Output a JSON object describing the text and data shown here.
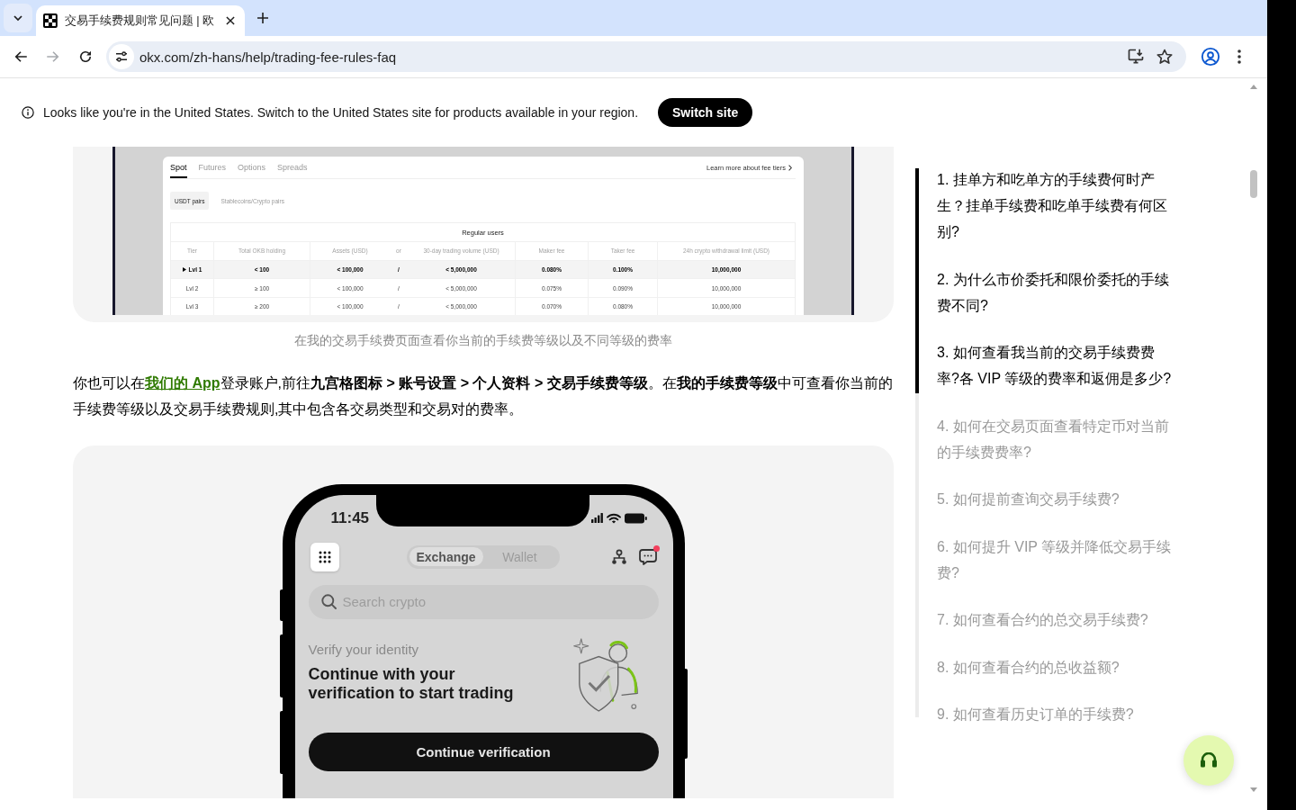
{
  "browser": {
    "tab_title": "交易手续费规则常见问题 | 欧",
    "nav_buttons": [
      {
        "kind": "back",
        "disabled": false
      },
      {
        "kind": "forward",
        "disabled": true
      },
      {
        "kind": "reload",
        "disabled": false
      }
    ],
    "address": "okx.com/zh-hans/help/trading-fee-rules-faq"
  },
  "region_banner": {
    "message": "Looks like you're in the United States. Switch to the United States site for products available in your region.",
    "button": "Switch site"
  },
  "fee_screenshot": {
    "tabs": [
      {
        "label": "Spot",
        "selected": true
      },
      {
        "label": "Futures",
        "selected": false
      },
      {
        "label": "Options",
        "selected": false
      },
      {
        "label": "Spreads",
        "selected": false
      }
    ],
    "fee_link": "Learn more about fee tiers",
    "pair_tabs": [
      {
        "label": "USDT pairs",
        "selected": true
      },
      {
        "label": "Stablecoins/Crypto pairs",
        "selected": false
      }
    ],
    "table": {
      "group_heading": "Regular users",
      "columns": [
        "Tier",
        "Total OKB holding",
        "Assets (USD)",
        "or",
        "30-day trading volume (USD)",
        "Maker fee",
        "Taker fee",
        "24h crypto withdrawal limit (USD)"
      ],
      "rows": [
        {
          "selected": true,
          "cells": [
            "Lvl 1",
            "< 100",
            "< 100,000",
            "/",
            "< 5,000,000",
            "0.080%",
            "0.100%",
            "10,000,000"
          ]
        },
        {
          "selected": false,
          "cells": [
            "Lvl 2",
            "≥ 100",
            "< 100,000",
            "/",
            "< 5,000,000",
            "0.075%",
            "0.090%",
            "10,000,000"
          ]
        },
        {
          "selected": false,
          "cells": [
            "Lvl 3",
            "≥ 200",
            "< 100,000",
            "/",
            "< 5,000,000",
            "0.070%",
            "0.080%",
            "10,000,000"
          ]
        }
      ]
    }
  },
  "fee_caption": "在我的交易手续费页面查看你当前的手续费等级以及不同等级的费率",
  "article_paragraph": [
    {
      "kind": "text",
      "text": "你也可以在"
    },
    {
      "kind": "link",
      "text": "我们的 App"
    },
    {
      "kind": "text",
      "text": "登录账户,前往**九宫格图标 > 账号设置 > 个人资料 > 交易手续费等级**。在**我的手续费等级**中可查看你当前的手续费等级以及交易手续费规则,其中包含各交易类型和交易对的费率。"
    }
  ],
  "app_screenshot": {
    "time": "11:45",
    "segments": [
      {
        "label": "Exchange",
        "selected": true
      },
      {
        "label": "Wallet",
        "selected": false
      }
    ],
    "messages_unread": true,
    "search": {
      "placeholder": "Search crypto"
    },
    "prompt": {
      "eyebrow": "Verify your identity",
      "title": "Continue with your verification to start trading",
      "button": "Continue verification"
    }
  },
  "toc": {
    "progress": {
      "level": 0.41
    },
    "items": [
      {
        "label": "1. 挂单方和吃单方的手续费何时产生？挂单手续费和吃单手续费有何区别?",
        "highlighted": true
      },
      {
        "label": "2. 为什么市价委托和限价委托的手续费不同?",
        "highlighted": true
      },
      {
        "label": "3. 如何查看我当前的交易手续费费率?各 VIP 等级的费率和返佣是多少?",
        "highlighted": true
      },
      {
        "label": "4. 如何在交易页面查看特定币对当前的手续费费率?",
        "highlighted": false
      },
      {
        "label": "5. 如何提前查询交易手续费?",
        "highlighted": false
      },
      {
        "label": "6. 如何提升 VIP 等级并降低交易手续费?",
        "highlighted": false
      },
      {
        "label": "7. 如何查看合约的总交易手续费?",
        "highlighted": false
      },
      {
        "label": "8. 如何查看合约的总收益额?",
        "highlighted": false
      },
      {
        "label": "9. 如何查看历史订单的手续费?",
        "highlighted": false
      }
    ]
  }
}
